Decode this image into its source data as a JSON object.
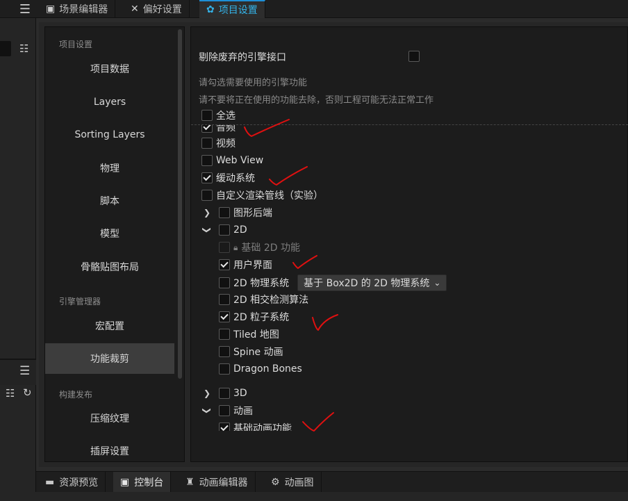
{
  "tabs": [
    {
      "label": "场景编辑器",
      "icon": "scene-icon"
    },
    {
      "label": "偏好设置",
      "icon": "tools-icon"
    },
    {
      "label": "项目设置",
      "icon": "gear-icon",
      "active": true
    }
  ],
  "nav": {
    "groups": [
      "项目设置",
      "引擎管理器",
      "构建发布"
    ],
    "items": [
      "项目数据",
      "Layers",
      "Sorting Layers",
      "物理",
      "脚本",
      "模型",
      "骨骼贴图布局",
      "宏配置",
      "功能裁剪",
      "压缩纹理",
      "插屏设置"
    ],
    "active_item": "功能裁剪"
  },
  "content": {
    "deprecated_label": "剔除废弃的引擎接口",
    "hint1": "请勾选需要使用的引擎功能",
    "hint2": "请不要将正在使用的功能去除，否则工程可能无法正常工作",
    "select_all": "全选",
    "audio": "音频",
    "video": "视频",
    "webview": "Web View",
    "tween": "缓动系统",
    "custom_pipeline": "自定义渲染管线（实验）",
    "graphics_backend": "图形后端",
    "twod": "2D",
    "twod_basic": "基础 2D 功能",
    "ui": "用户界面",
    "physics2d": "2D 物理系统",
    "physics2d_option": "基于 Box2D 的 2D 物理系统",
    "intersection2d": "2D 相交检测算法",
    "particle2d": "2D 粒子系统",
    "tiled": "Tiled 地图",
    "spine": "Spine 动画",
    "dragonbones": "Dragon Bones",
    "threed": "3D",
    "animation": "动画",
    "animation_basic": "基础动画功能"
  },
  "checked": {
    "deprecated": false,
    "select_all": false,
    "audio": true,
    "video": false,
    "webview": false,
    "tween": true,
    "custom_pipeline": false,
    "graphics_backend": false,
    "twod": false,
    "twod_basic": false,
    "ui": true,
    "physics2d": false,
    "intersection2d": false,
    "particle2d": true,
    "tiled": false,
    "spine": false,
    "dragonbones": false,
    "threed": false,
    "animation": false,
    "animation_basic": true
  },
  "bottom_tabs": [
    {
      "label": "资源预览",
      "icon": "image-icon"
    },
    {
      "label": "控制台",
      "icon": "terminal-icon",
      "active": true
    },
    {
      "label": "动画编辑器",
      "icon": "running-icon"
    },
    {
      "label": "动画图",
      "icon": "node-graph-icon"
    }
  ],
  "colors": {
    "accent": "#34b3e9",
    "annotation": "#e01010"
  }
}
